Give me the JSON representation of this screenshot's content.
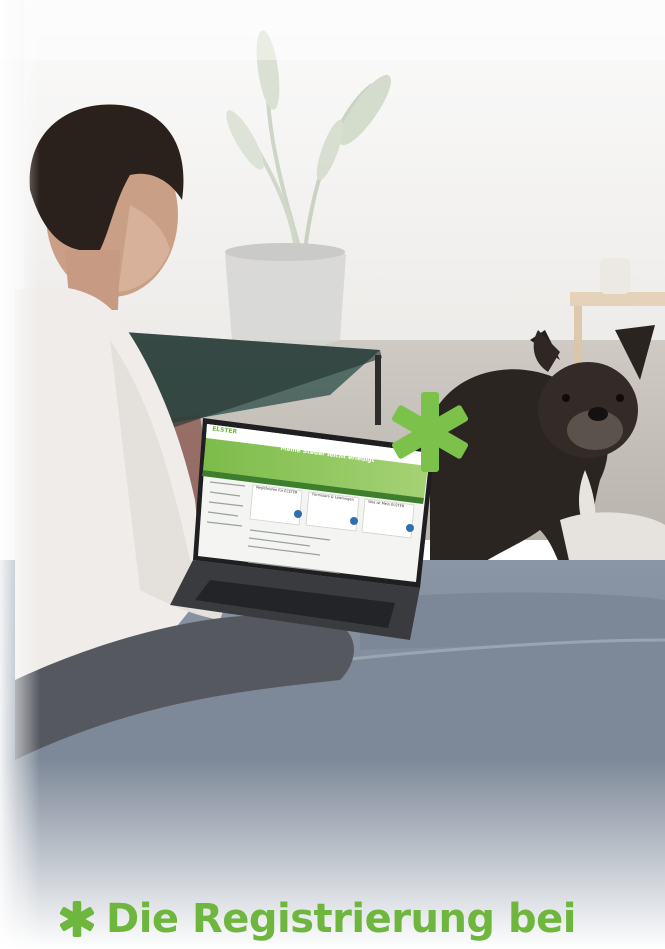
{
  "headline": {
    "text": "Die Registrierung bei",
    "icon": "asterisk-icon"
  },
  "laptop_screen": {
    "logo": "ELSTER",
    "banner_title": "Meine Steuer leicht erledigt",
    "cards": [
      "Registrieren für ELSTER",
      "Formulare & Leistungen",
      "Was ist Mein ELSTER"
    ]
  },
  "colors": {
    "brand_green": "#6fb63f",
    "sofa_blue": "#7f8c9c",
    "dog_dark": "#2b2522"
  }
}
